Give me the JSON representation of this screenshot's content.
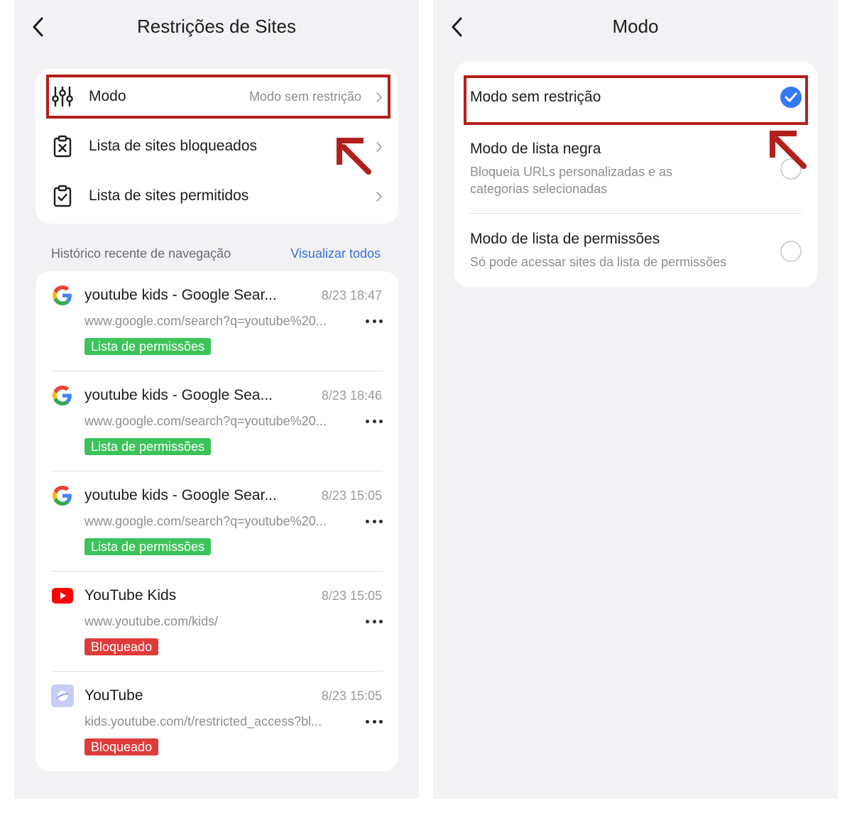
{
  "left_screen": {
    "title": "Restrições de Sites",
    "menu": [
      {
        "label": "Modo",
        "value": "Modo sem restrição",
        "icon": "sliders-icon"
      },
      {
        "label": "Lista de sites bloqueados",
        "value": "",
        "icon": "clipboard-x-icon"
      },
      {
        "label": "Lista de sites permitidos",
        "value": "",
        "icon": "clipboard-check-icon"
      }
    ],
    "history_header": "Histórico recente de navegação",
    "view_all": "Visualizar todos",
    "history": [
      {
        "title": "youtube kids - Google Sear...",
        "time": "8/23 18:47",
        "url": "www.google.com/search?q=youtube%20...",
        "badge": "Lista de permissões",
        "badge_type": "allowed",
        "favicon": "google-icon"
      },
      {
        "title": "youtube kids - Google Sea...",
        "time": "8/23 18:46",
        "url": "www.google.com/search?q=youtube%20...",
        "badge": "Lista de permissões",
        "badge_type": "allowed",
        "favicon": "google-icon"
      },
      {
        "title": "youtube kids - Google Sear...",
        "time": "8/23 15:05",
        "url": "www.google.com/search?q=youtube%20...",
        "badge": "Lista de permissões",
        "badge_type": "allowed",
        "favicon": "google-icon"
      },
      {
        "title": "YouTube Kids",
        "time": "8/23 15:05",
        "url": "www.youtube.com/kids/",
        "badge": "Bloqueado",
        "badge_type": "blocked",
        "favicon": "youtube-icon"
      },
      {
        "title": "YouTube",
        "time": "8/23 15:05",
        "url": "kids.youtube.com/t/restricted_access?bl...",
        "badge": "Bloqueado",
        "badge_type": "blocked",
        "favicon": "generic-site-icon"
      }
    ]
  },
  "right_screen": {
    "title": "Modo",
    "options": [
      {
        "title": "Modo sem restrição",
        "description": "",
        "selected": true
      },
      {
        "title": "Modo de lista negra",
        "description": "Bloqueia URLs personalizadas e as categorias selecionadas",
        "selected": false
      },
      {
        "title": "Modo de lista de permissões",
        "description": "Só pode acessar sites da lista de permissões",
        "selected": false
      }
    ]
  },
  "colors": {
    "background": "#f2f2f4",
    "card": "#ffffff",
    "highlight": "#b3201b",
    "link": "#3a6fd8",
    "badge_allowed": "#3cc45b",
    "badge_blocked": "#e03b3b",
    "radio_selected": "#3478f6"
  }
}
